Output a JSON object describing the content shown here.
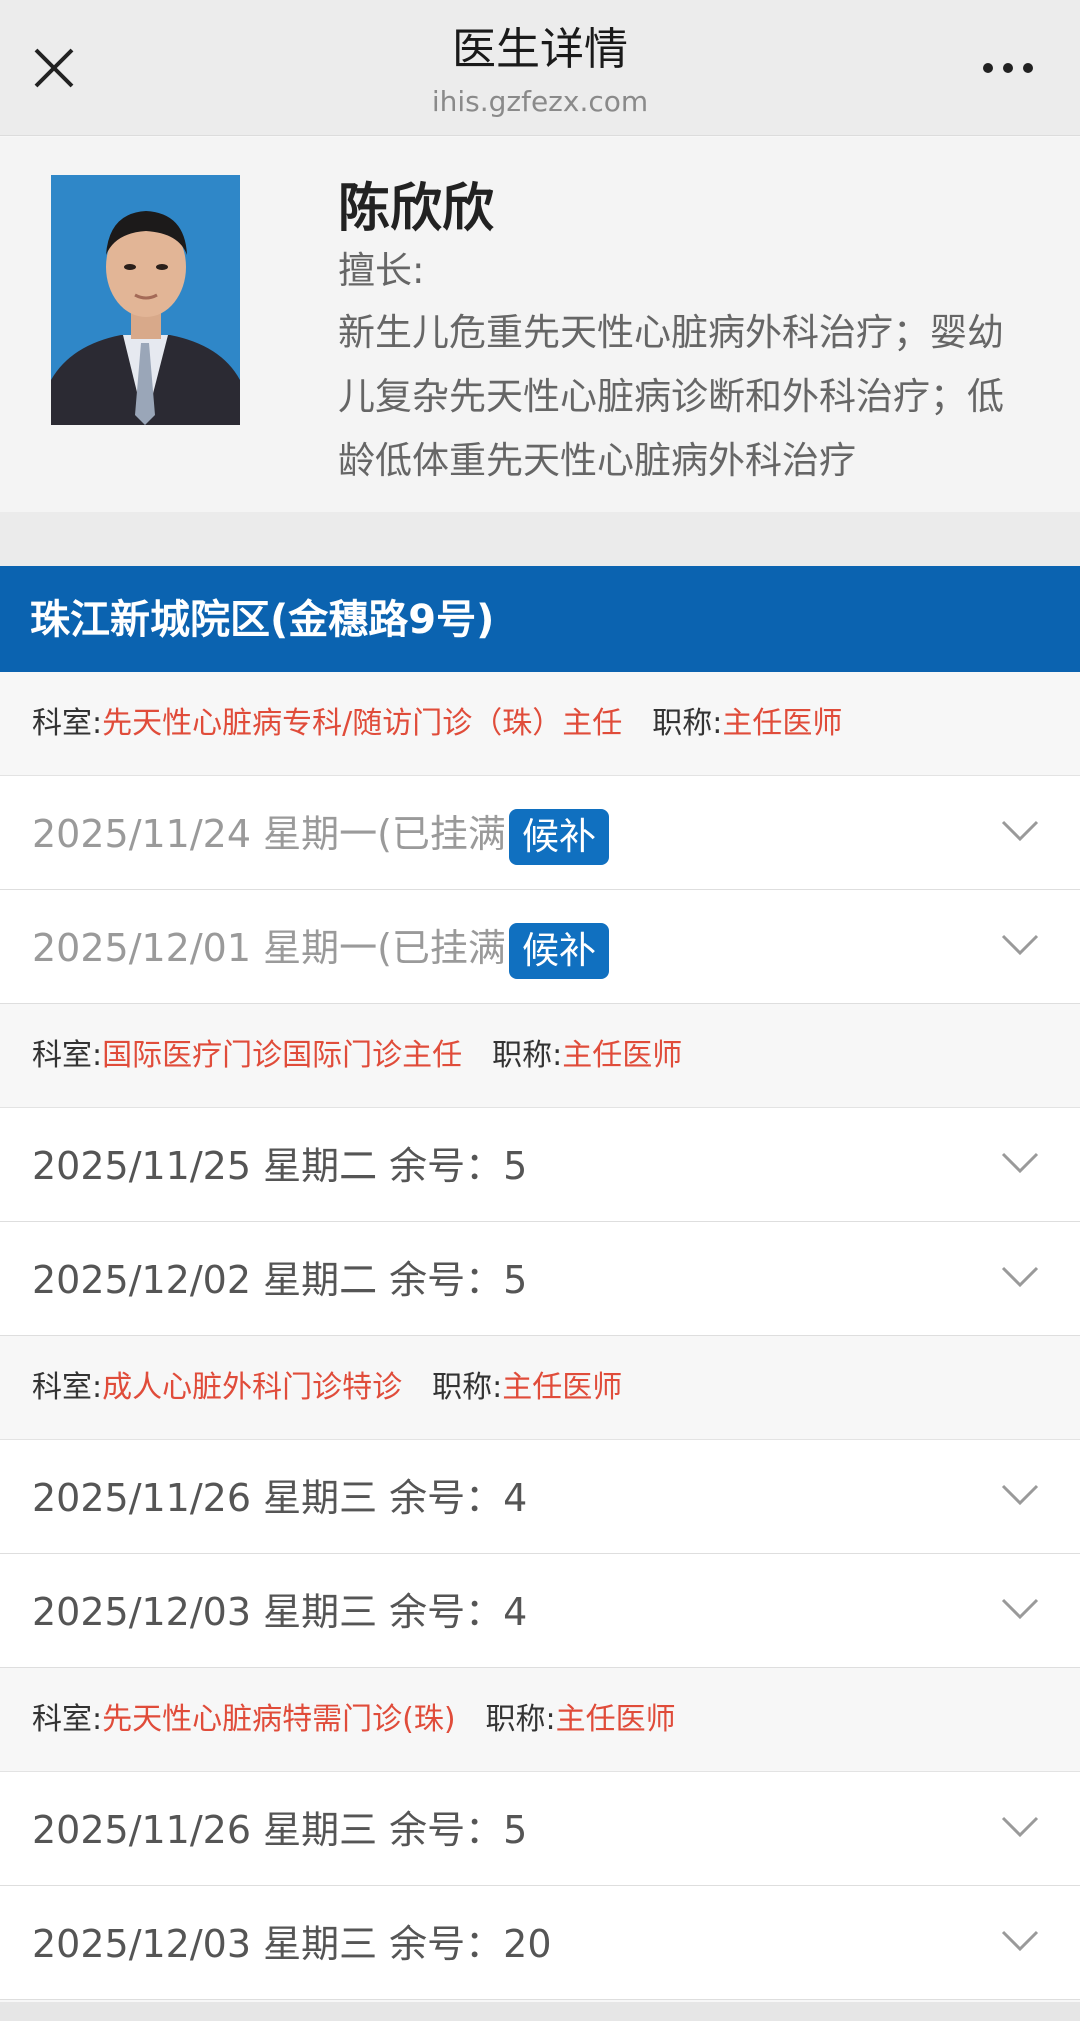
{
  "nav": {
    "title": "医生详情",
    "host": "ihis.gzfezx.com"
  },
  "doctor": {
    "name": "陈欣欣",
    "specialty_label": "擅长:",
    "specialty": "新生儿危重先天性心脏病外科治疗；婴幼儿复杂先天性心脏病诊断和外科治疗；低龄低体重先天性心脏病外科治疗"
  },
  "campus": {
    "name": "珠江新城院区(金穗路9号)"
  },
  "labels": {
    "dept": "科室:",
    "rank": "职称:"
  },
  "departments": [
    {
      "dept": "先天性心脏病专科/随访门诊（珠）主任",
      "rank": "主任医师",
      "slots": [
        {
          "text": "2025/11/24 星期一(已挂满)",
          "badge": "候补",
          "full": true
        },
        {
          "text": "2025/12/01 星期一(已挂满)",
          "badge": "候补",
          "full": true
        }
      ]
    },
    {
      "dept": "国际医疗门诊国际门诊主任",
      "rank": "主任医师",
      "slots": [
        {
          "text": "2025/11/25 星期二 余号：5"
        },
        {
          "text": "2025/12/02 星期二 余号：5"
        }
      ]
    },
    {
      "dept": "成人心脏外科门诊特诊",
      "rank": "主任医师",
      "slots": [
        {
          "text": "2025/11/26 星期三 余号：4"
        },
        {
          "text": "2025/12/03 星期三 余号：4"
        }
      ]
    },
    {
      "dept": "先天性心脏病特需门诊(珠)",
      "rank": "主任医师",
      "slots": [
        {
          "text": "2025/11/26 星期三 余号：5"
        },
        {
          "text": "2025/12/03 星期三 余号：20"
        }
      ]
    }
  ],
  "icons": {
    "close": "close-icon",
    "more": "more-icon",
    "expand": "chevron-down-icon"
  },
  "colors": {
    "accent_blue": "#0b63b0",
    "badge_blue": "#1070c0",
    "value_red": "#e04c3a"
  }
}
